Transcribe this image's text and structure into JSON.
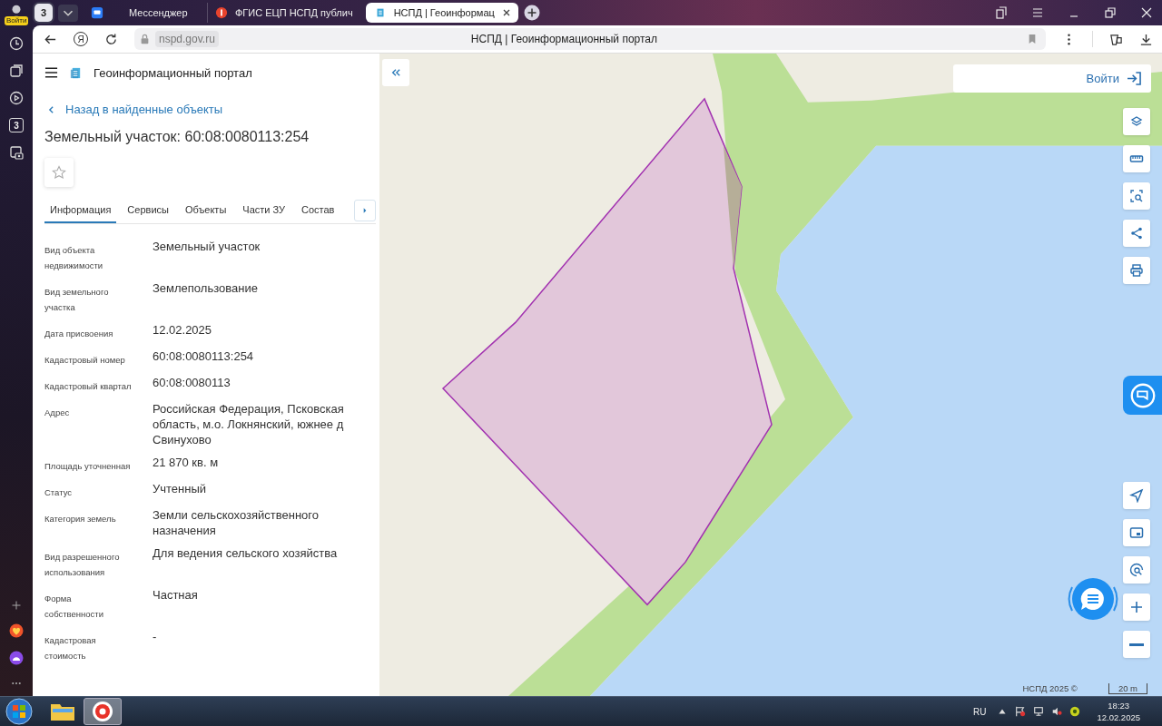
{
  "browser": {
    "profile_label": "Войти",
    "tab_count": "3",
    "tabs": [
      {
        "title": "Мессенджер",
        "kind": "messenger",
        "selected": false
      },
      {
        "title": "ФГИС ЕЦП НСПД публич",
        "kind": "yandex",
        "selected": false
      },
      {
        "title": "НСПД | Геоинформац",
        "kind": "portal",
        "selected": true
      }
    ],
    "yandex_button": "Я",
    "url": "nspd.gov.ru",
    "page_title": "НСПД | Геоинформационный портал",
    "side_badge": "3"
  },
  "portal": {
    "title": "Геоинформационный портал",
    "back_link": "Назад в найденные объекты",
    "heading": "Земельный участок: 60:08:0080113:254",
    "favorite": false,
    "tabs": [
      {
        "label": "Информация",
        "selected": true
      },
      {
        "label": "Сервисы",
        "selected": false
      },
      {
        "label": "Объекты",
        "selected": false
      },
      {
        "label": "Части ЗУ",
        "selected": false
      },
      {
        "label": "Состав",
        "selected": false
      }
    ],
    "fields": [
      {
        "label": "Вид объекта недвижимости",
        "value": "Земельный участок"
      },
      {
        "label": "Вид земельного участка",
        "value": "Землепользование"
      },
      {
        "label": "Дата присвоения",
        "value": "12.02.2025"
      },
      {
        "label": "Кадастровый номер",
        "value": "60:08:0080113:254"
      },
      {
        "label": "Кадастровый квартал",
        "value": "60:08:0080113"
      },
      {
        "label": "Адрес",
        "value": "Российская Федерация, Псковская область, м.о. Локнянский, южнее д Свинухово"
      },
      {
        "label": "Площадь уточненная",
        "value": "21 870 кв. м"
      },
      {
        "label": "Статус",
        "value": "Учтенный"
      },
      {
        "label": "Категория земель",
        "value": "Земли сельскохозяйственного назначения"
      },
      {
        "label": "Вид разрешенного использования",
        "value": "Для ведения сельского хозяйства"
      },
      {
        "label": "Форма собственности",
        "value": "Частная"
      },
      {
        "label": "Кадастровая стоимость",
        "value": "-"
      }
    ]
  },
  "map": {
    "login": "Войти",
    "attribution": "НСПД 2025 ©",
    "scale": "20 m"
  },
  "taskbar": {
    "language": "RU",
    "time": "18:23",
    "date": "12.02.2025"
  }
}
